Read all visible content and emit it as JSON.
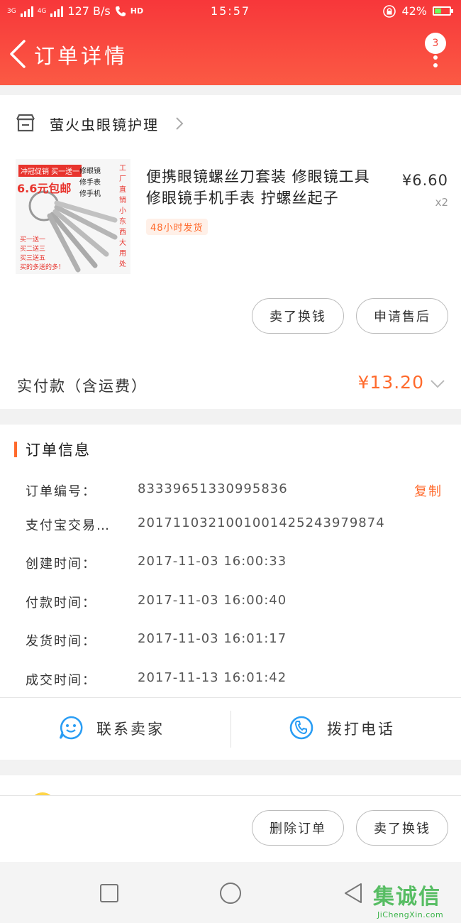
{
  "status_bar": {
    "network_left": "3G",
    "network_right": "4G",
    "speed": "127 B/s",
    "hd": "HD",
    "time": "15:57",
    "battery": "42%",
    "battery_level": 0.42
  },
  "header": {
    "title": "订单详情",
    "notification_count": "3"
  },
  "store": {
    "name": "萤火虫眼镜护理"
  },
  "product": {
    "title": "便携眼镜螺丝刀套装 修眼镜工具 修眼镜手机手表 拧螺丝起子",
    "price": "¥6.60",
    "quantity": "x2",
    "shipping_tag": "48小时发货",
    "thumbnail": {
      "promo_top": "冲冠促销 买一送一",
      "price": "6.6元包邮",
      "labels": [
        "修眼镜",
        "修手表",
        "修手机"
      ],
      "side_text": "工厂直销 小东西大用处",
      "deals": [
        "买一送一",
        "买二送三",
        "买三送五",
        "买的多送的多！"
      ]
    }
  },
  "product_actions": {
    "refund_label": "卖了换钱",
    "after_sale_label": "申请售后"
  },
  "payment": {
    "label": "实付款（含运费）",
    "amount": "¥13.20"
  },
  "order_info": {
    "title": "订单信息",
    "copy_label": "复制",
    "rows": [
      {
        "label": "订单编号：",
        "value": "83339651330995836"
      },
      {
        "label": "支付宝交易…",
        "value": "2017110321001001425243979874"
      },
      {
        "label": "创建时间：",
        "value": "2017-11-03 16:00:33"
      },
      {
        "label": "付款时间：",
        "value": "2017-11-03 16:00:40"
      },
      {
        "label": "发货时间：",
        "value": "2017-11-03 16:01:17"
      },
      {
        "label": "成交时间：",
        "value": "2017-11-13 16:01:42"
      }
    ]
  },
  "contact": {
    "seller_label": "联系卖家",
    "call_label": "拨打电话"
  },
  "bottom_actions": {
    "delete_label": "删除订单",
    "resell_label": "卖了换钱"
  },
  "watermark": {
    "main": "集诚信",
    "sub": "JiChengXin.com"
  },
  "colors": {
    "header_red": "#f7373a",
    "accent_orange": "#ff6a2c",
    "contact_blue": "#2a9df4"
  }
}
